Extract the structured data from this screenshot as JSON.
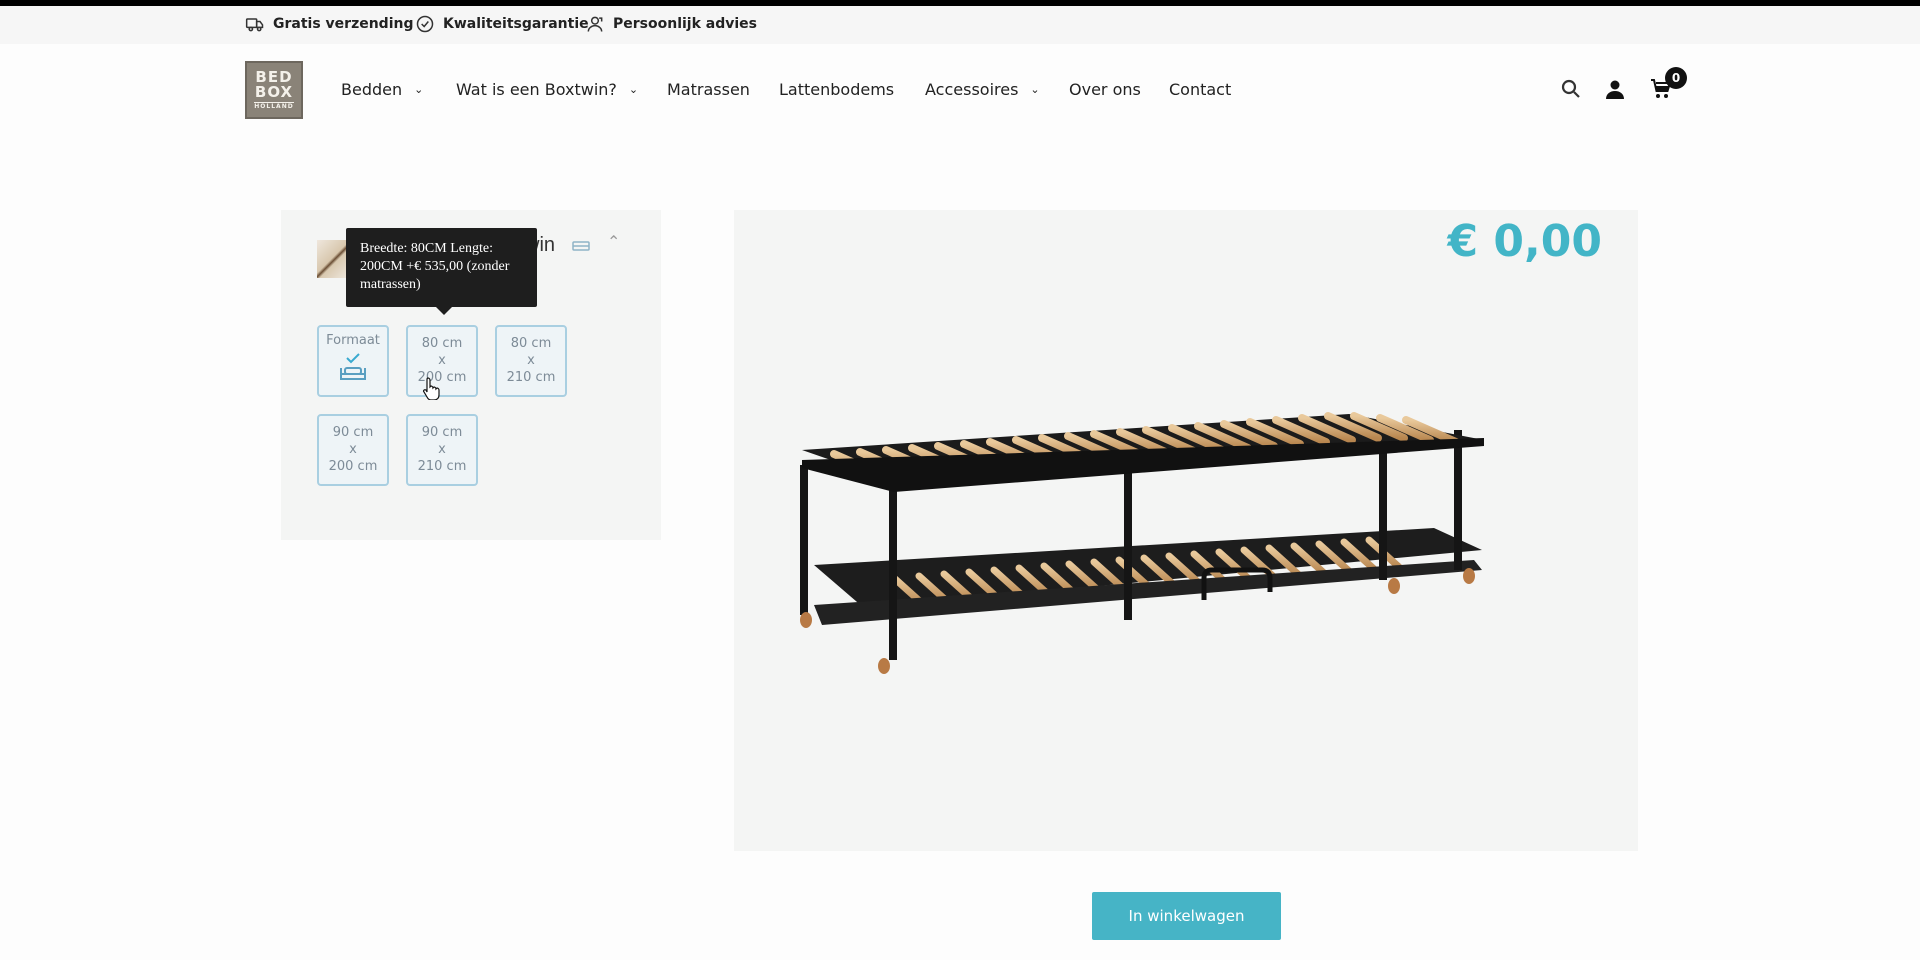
{
  "usp": [
    {
      "label": "Gratis verzending",
      "icon": "truck-icon"
    },
    {
      "label": "Kwaliteitsgarantie",
      "icon": "badge-check-icon"
    },
    {
      "label": "Persoonlijk advies",
      "icon": "person-support-icon"
    }
  ],
  "logo": {
    "line1": "BED",
    "line2": "BOX",
    "line3": "HOLLAND"
  },
  "nav": [
    {
      "label": "Bedden",
      "dropdown": true
    },
    {
      "label": "Wat is een Boxtwin?",
      "dropdown": true
    },
    {
      "label": "Matrassen",
      "dropdown": false
    },
    {
      "label": "Lattenbodems",
      "dropdown": false
    },
    {
      "label": "Accessoires",
      "dropdown": true
    },
    {
      "label": "Over ons",
      "dropdown": false
    },
    {
      "label": "Contact",
      "dropdown": false
    }
  ],
  "header": {
    "cart_count": "0"
  },
  "config": {
    "title_fragment": "win",
    "format_label": "Formaat",
    "options": [
      {
        "w": "80 cm",
        "x": "x",
        "l": "200 cm"
      },
      {
        "w": "80 cm",
        "x": "x",
        "l": "210 cm"
      },
      {
        "w": "90 cm",
        "x": "x",
        "l": "200 cm"
      },
      {
        "w": "90 cm",
        "x": "x",
        "l": "210 cm"
      }
    ],
    "tooltip": "Breedte: 80CM Lengte: 200CM +€ 535,00 (zonder matrassen)"
  },
  "product": {
    "price": "€ 0,00"
  },
  "cart_button": {
    "label": "In winkelwagen"
  },
  "colors": {
    "accent": "#42b5c7",
    "button": "#46b4c6",
    "option_border": "#a9cfe1"
  }
}
